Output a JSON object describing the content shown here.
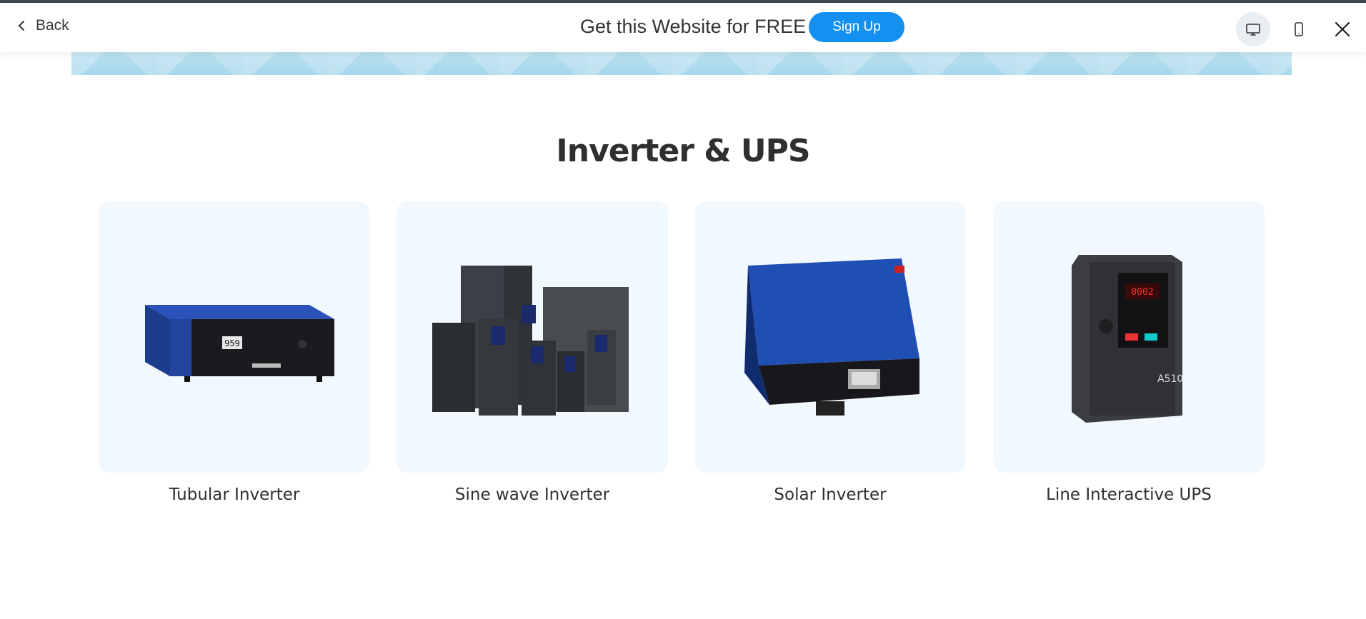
{
  "topbar": {
    "back_label": "Back",
    "promo_text": "Get this Website for FREE",
    "signup_label": "Sign Up",
    "accent_color": "#1490f0"
  },
  "icons": {
    "back": "chevron-left-icon",
    "desktop": "desktop-icon",
    "mobile": "mobile-icon",
    "close": "close-icon"
  },
  "section": {
    "title": "Inverter & UPS"
  },
  "products": [
    {
      "label": "Tubular Inverter",
      "image": "blue inverter unit"
    },
    {
      "label": "Sine wave Inverter",
      "image": "group of drive units"
    },
    {
      "label": "Solar Inverter",
      "image": "blue solar inverter"
    },
    {
      "label": "Line Interactive UPS",
      "image": "dark drive unit"
    }
  ]
}
